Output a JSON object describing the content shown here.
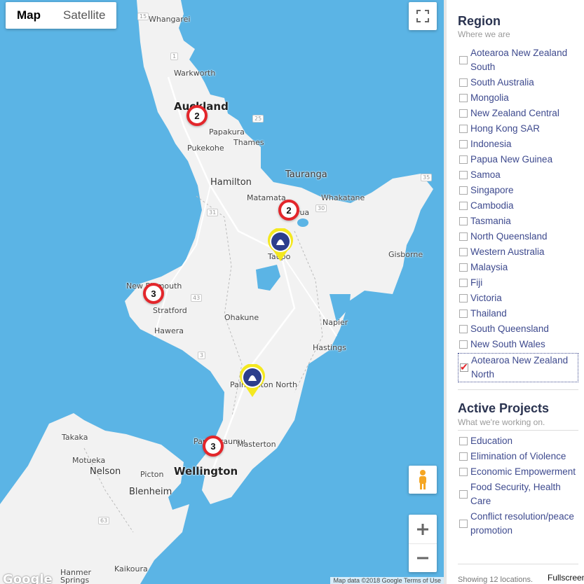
{
  "map": {
    "type_buttons": [
      "Map",
      "Satellite"
    ],
    "places": {
      "whangarei": "Whangarei",
      "warkworth": "Warkworth",
      "auckland": "Auckland",
      "papakura": "Papakura",
      "pukekohe": "Pukekohe",
      "thames": "Thames",
      "tauranga": "Tauranga",
      "hamilton": "Hamilton",
      "matamata": "Matamata",
      "whakatane": "Whakatane",
      "rotorua": "Rotorua",
      "taupo": "Taupo",
      "gisborne": "Gisborne",
      "new_plymouth": "New Plymouth",
      "stratford": "Stratford",
      "hawera": "Hawera",
      "ohakune": "Ohakune",
      "napier": "Napier",
      "hastings": "Hastings",
      "palmerston_north": "Palmerston North",
      "paraparaumu": "Paraparaumu",
      "masterton": "Masterton",
      "wellington": "Wellington",
      "takaka": "Takaka",
      "motueka": "Motueka",
      "nelson": "Nelson",
      "picton": "Picton",
      "blenheim": "Blenheim",
      "kaikoura": "Kaikoura",
      "hanmer_springs": "Hanmer Springs"
    },
    "clusters": [
      "2",
      "2",
      "3",
      "3"
    ],
    "google_logo": "Google",
    "attribution": "Map data ©2018 Google   Terms of Use"
  },
  "region": {
    "title": "Region",
    "subtitle": "Where we are",
    "items": [
      "Aotearoa New Zealand South",
      "South Australia",
      "Mongolia",
      "New Zealand Central",
      "Hong Kong SAR",
      "Indonesia",
      "Papua New Guinea",
      "Samoa",
      "Singapore",
      "Cambodia",
      "Tasmania",
      "North Queensland",
      "Western Australia",
      "Malaysia",
      "Fiji",
      "Victoria",
      "Thailand",
      "South Queensland",
      "New South Wales",
      "Aotearoa New Zealand North"
    ],
    "checked": "Aotearoa New Zealand North"
  },
  "projects": {
    "title": "Active Projects",
    "subtitle": "What we're working on.",
    "items": [
      "Education",
      "Elimination of Violence",
      "Economic Empowerment",
      "Food Security, Health Care",
      "Conflict resolution/peace promotion"
    ]
  },
  "footer": {
    "showing": "Showing 12 locations.",
    "fullscreen": "Fullscreen"
  },
  "colors": {
    "water": "#5bb4e5",
    "land": "#f2f2f2",
    "accent": "#3e4a8e",
    "cluster_ring": "#e3262b"
  }
}
